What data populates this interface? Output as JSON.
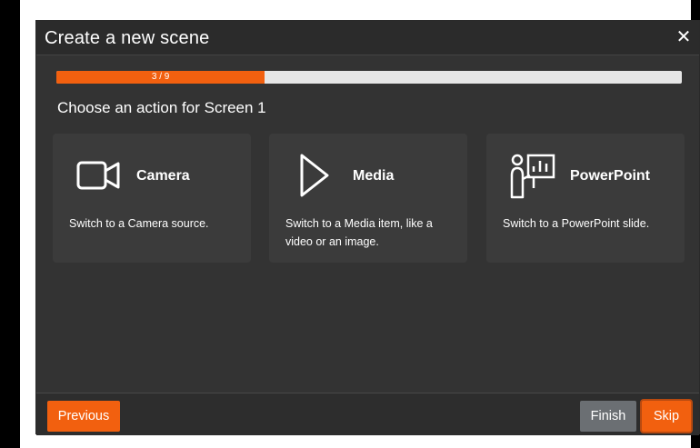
{
  "dialog": {
    "title": "Create a new scene",
    "close_icon": "close-icon",
    "progress": {
      "text": "3 / 9",
      "current": 3,
      "total": 9,
      "fraction": 0.3333
    },
    "subtitle": "Choose an action for Screen 1",
    "cards": [
      {
        "icon": "camera-icon",
        "title": "Camera",
        "description": "Switch to a Camera source."
      },
      {
        "icon": "play-icon",
        "title": "Media",
        "description": "Switch to a Media item, like a video or an image."
      },
      {
        "icon": "presenter-icon",
        "title": "PowerPoint",
        "description": "Switch to a PowerPoint slide."
      }
    ]
  },
  "footer": {
    "previous_label": "Previous",
    "finish_label": "Finish",
    "skip_label": "Skip"
  },
  "colors": {
    "accent": "#f2600f",
    "dialog_bg": "#333333",
    "card_bg": "#3b3b3b",
    "finish_bg": "#6b6f73"
  }
}
